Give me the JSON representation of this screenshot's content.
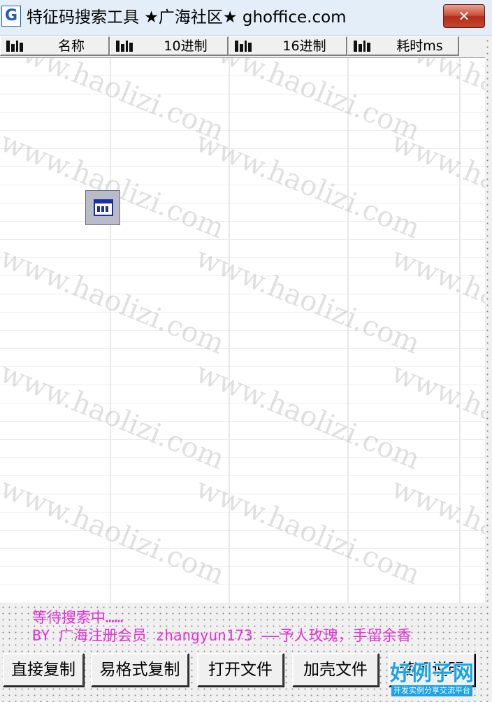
{
  "window": {
    "icon_glyph": "G",
    "title": "特征码搜索工具 ★广海社区★ ghoffice.com",
    "close_glyph": "✕"
  },
  "table": {
    "columns": [
      {
        "label": "名称"
      },
      {
        "label": "10进制"
      },
      {
        "label": "16进制"
      },
      {
        "label": "耗时ms"
      }
    ],
    "rows": []
  },
  "watermark": "www.haolizi.com",
  "status": {
    "line1": "等待搜索中……",
    "line2": "BY 广海注册会员 zhangyun173 ——予人玫瑰，手留余香"
  },
  "buttons": {
    "copy_direct": "直接复制",
    "copy_easy_format": "易格式复制",
    "open_file": "打开文件",
    "packed_file": "加壳文件",
    "instructions": "使用说明"
  },
  "logo": {
    "main": "好例子网",
    "sub": "开发实例分享交流平台"
  },
  "colors": {
    "status_text": "#e82fd8",
    "close_button": "#c74c38",
    "logo": "#1aa3e8"
  }
}
